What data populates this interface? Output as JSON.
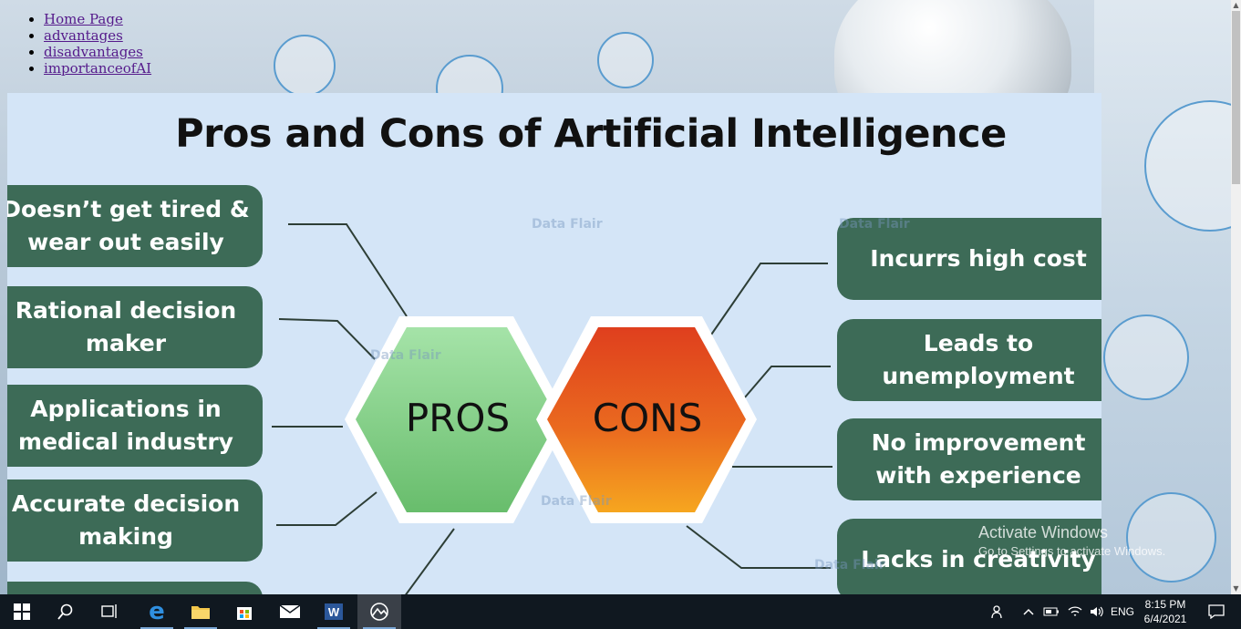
{
  "nav": {
    "items": [
      {
        "label": "Home Page"
      },
      {
        "label": "advantages"
      },
      {
        "label": "disadvantages"
      },
      {
        "label": "importanceofAI"
      }
    ]
  },
  "infographic": {
    "title": "Pros and Cons of Artificial Intelligence",
    "pros_label": "PROS",
    "cons_label": "CONS",
    "pros": [
      "Doesn’t get tired &\nwear out easily",
      "Rational decision\nmaker",
      "Applications in\nmedical industry",
      "Accurate decision\nmaking"
    ],
    "cons": [
      "Incurrs high cost",
      "Leads to\nunemployment",
      "No improvement\nwith experience",
      "Lacks in creativity"
    ],
    "watermark": "Data Flair",
    "colors": {
      "box": "#3d6b57",
      "pros_hex": "#7ccb7c",
      "cons_hex": "#e2521f",
      "background": "#d4e5f7"
    }
  },
  "activation": {
    "title": "Activate Windows",
    "subtitle": "Go to Settings to activate Windows."
  },
  "taskbar": {
    "icons": [
      "windows-start-icon",
      "search-icon",
      "task-view-icon",
      "edge-icon",
      "file-explorer-icon",
      "store-icon",
      "mail-icon",
      "word-icon",
      "photos-icon"
    ],
    "tray": {
      "language": "ENG",
      "time": "8:15 PM",
      "date": "6/4/2021"
    }
  }
}
